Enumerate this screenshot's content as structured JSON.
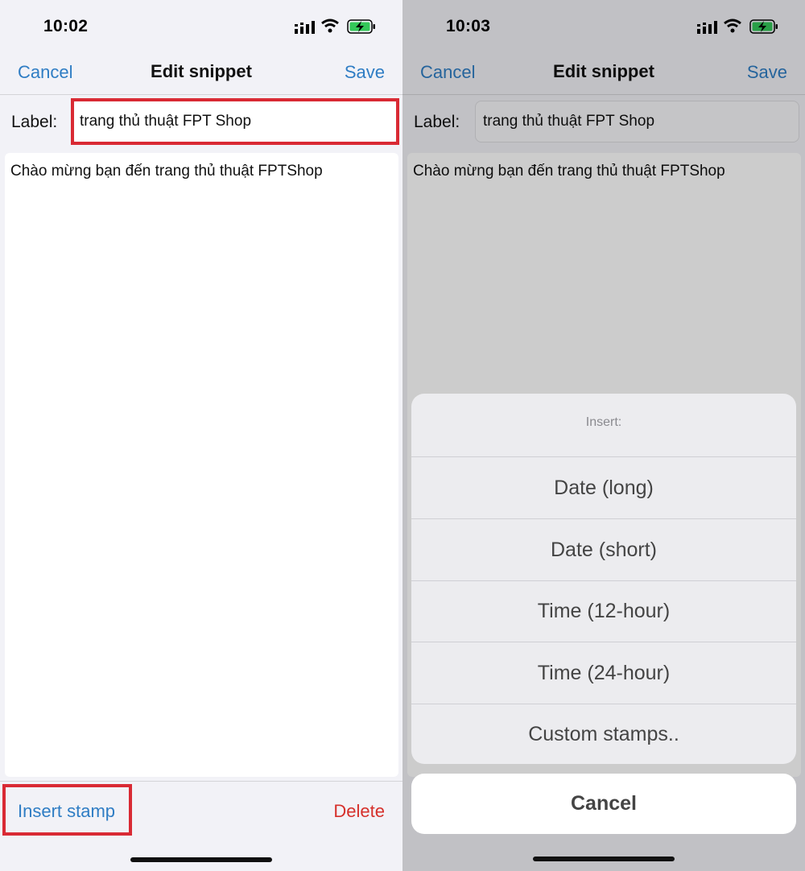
{
  "left": {
    "status": {
      "time": "10:02"
    },
    "nav": {
      "cancel": "Cancel",
      "title": "Edit snippet",
      "save": "Save"
    },
    "label": {
      "caption": "Label:",
      "value": "trang thủ thuật FPT Shop"
    },
    "body_text": "Chào mừng bạn đến trang thủ thuật FPTShop",
    "toolbar": {
      "insert_stamp": "Insert stamp",
      "delete": "Delete"
    }
  },
  "right": {
    "status": {
      "time": "10:03"
    },
    "nav": {
      "cancel": "Cancel",
      "title": "Edit snippet",
      "save": "Save"
    },
    "label": {
      "caption": "Label:",
      "value": "trang thủ thuật FPT Shop"
    },
    "body_text": "Chào mừng bạn đến trang thủ thuật FPTShop",
    "sheet": {
      "title": "Insert:",
      "options": [
        "Date (long)",
        "Date (short)",
        "Time (12-hour)",
        "Time (24-hour)",
        "Custom stamps.."
      ],
      "cancel": "Cancel"
    }
  },
  "colors": {
    "accent": "#2f7dc4",
    "destructive": "#d6302b",
    "highlight": "#d92a34",
    "battery": "#34c759"
  },
  "icons": [
    "signal-icon",
    "wifi-icon",
    "battery-charging-icon"
  ]
}
